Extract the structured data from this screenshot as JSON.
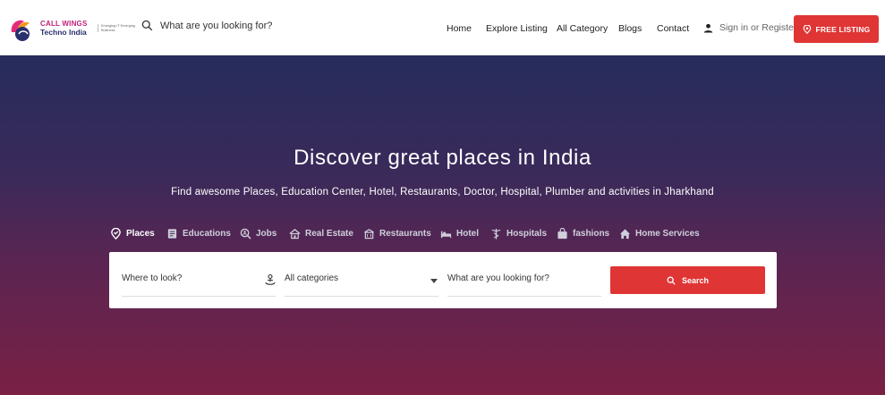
{
  "header": {
    "logo": {
      "name_line1": "CALL WINGS",
      "name_line2": "Techno India",
      "tagline": "Emerging IT Emerging Business"
    },
    "search_placeholder": "What are you looking for?",
    "nav": [
      "Home",
      "Explore Listing",
      "All Category",
      "Blogs",
      "Contact"
    ],
    "signin_label": "Sign in or Register",
    "free_listing_label": "FREE LISTING"
  },
  "hero": {
    "title": "Discover great places in India",
    "subtitle": "Find awesome Places, Education Center, Hotel, Restaurants, Doctor, Hospital, Plumber and activities in Jharkhand",
    "categories": [
      {
        "label": "Places",
        "icon": "map-pin-icon",
        "active": true
      },
      {
        "label": "Educations",
        "icon": "book-icon",
        "active": false
      },
      {
        "label": "Jobs",
        "icon": "search-person-icon",
        "active": false
      },
      {
        "label": "Real Estate",
        "icon": "house-icon",
        "active": false
      },
      {
        "label": "Restaurants",
        "icon": "restaurant-icon",
        "active": false
      },
      {
        "label": "Hotel",
        "icon": "bed-icon",
        "active": false
      },
      {
        "label": "Hospitals",
        "icon": "caduceus-icon",
        "active": false
      },
      {
        "label": "fashions",
        "icon": "shopping-bag-icon",
        "active": false
      },
      {
        "label": "Home Services",
        "icon": "home-icon",
        "active": false
      }
    ]
  },
  "search": {
    "where_placeholder": "Where to look?",
    "category_value": "All categories",
    "what_placeholder": "What are you looking for?",
    "button_label": "Search"
  },
  "colors": {
    "accent": "#e03535",
    "hero_top": "#262c5c",
    "hero_bottom": "#7a2044"
  }
}
